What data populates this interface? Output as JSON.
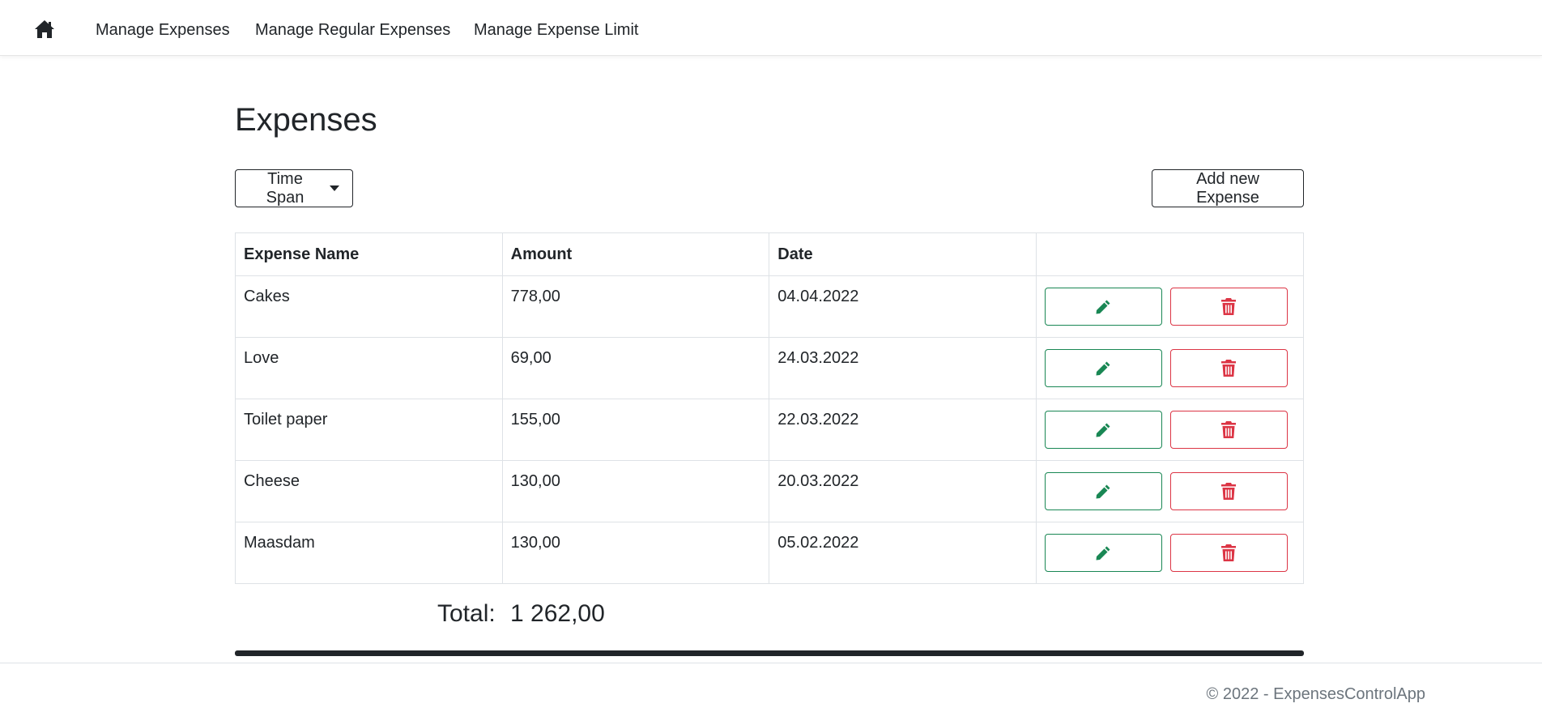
{
  "nav": {
    "home_icon": "home-icon",
    "links": [
      "Manage Expenses",
      "Manage Regular Expenses",
      "Manage Expense Limit"
    ]
  },
  "page": {
    "title": "Expenses",
    "time_span_label": "Time Span",
    "add_button_label": "Add new Expense"
  },
  "table": {
    "headers": [
      "Expense Name",
      "Amount",
      "Date",
      ""
    ],
    "rows": [
      {
        "name": "Cakes",
        "amount": "778,00",
        "date": "04.04.2022"
      },
      {
        "name": "Love",
        "amount": "69,00",
        "date": "24.03.2022"
      },
      {
        "name": "Toilet paper",
        "amount": "155,00",
        "date": "22.03.2022"
      },
      {
        "name": "Cheese",
        "amount": "130,00",
        "date": "20.03.2022"
      },
      {
        "name": "Maasdam",
        "amount": "130,00",
        "date": "05.02.2022"
      }
    ],
    "edit_icon": "pencil-icon",
    "delete_icon": "trash-icon"
  },
  "total": {
    "label": "Total:",
    "value": "1 262,00"
  },
  "footer": {
    "text": "© 2022 - ExpensesControlApp"
  },
  "colors": {
    "edit": "#198754",
    "delete": "#dc3545",
    "text": "#212529",
    "muted": "#6c757d"
  }
}
